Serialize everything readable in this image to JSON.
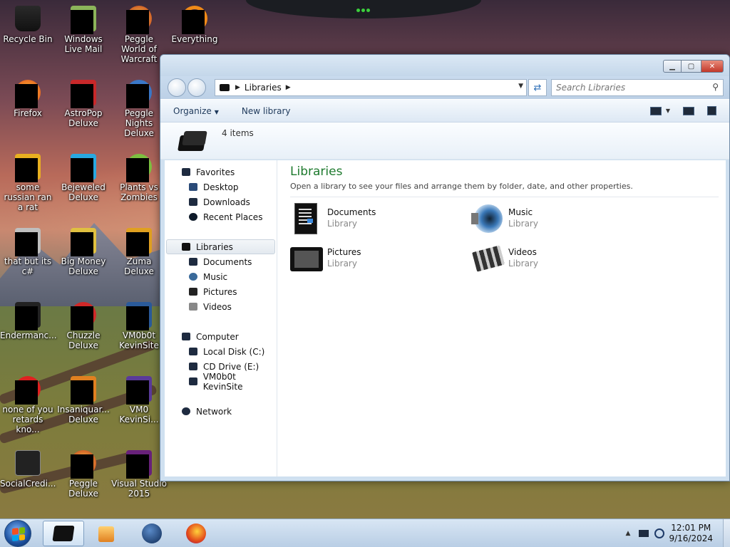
{
  "desktop": {
    "icons": [
      {
        "label": "Recycle Bin",
        "icon": "recycle-bin-icon"
      },
      {
        "label": "Windows Live Mail",
        "icon": "mail-icon"
      },
      {
        "label": "Peggle World of Warcraft",
        "icon": "game-icon"
      },
      {
        "label": "Everything",
        "icon": "search-app-icon"
      },
      {
        "label": "Firefox",
        "icon": "firefox-icon"
      },
      {
        "label": "AstroPop Deluxe",
        "icon": "game-icon"
      },
      {
        "label": "Peggle Nights Deluxe",
        "icon": "game-icon"
      },
      {
        "label": "some russian ran a rat",
        "icon": "app-icon"
      },
      {
        "label": "Bejeweled Deluxe",
        "icon": "game-icon"
      },
      {
        "label": "Plants vs Zombies",
        "icon": "game-icon"
      },
      {
        "label": "that but its c#",
        "icon": "app-icon"
      },
      {
        "label": "Big Money Deluxe",
        "icon": "game-icon"
      },
      {
        "label": "Zuma Deluxe",
        "icon": "game-icon"
      },
      {
        "label": "Endermanc...",
        "icon": "app-icon"
      },
      {
        "label": "Chuzzle Deluxe",
        "icon": "game-icon"
      },
      {
        "label": "VM0b0t KevinSite",
        "icon": "app-icon"
      },
      {
        "label": "none of you retards kno...",
        "icon": "app-icon"
      },
      {
        "label": "Insaniquar... Deluxe",
        "icon": "game-icon"
      },
      {
        "label": "VM0 KevinSi...",
        "icon": "app-icon"
      },
      {
        "label": "SocialCredi...",
        "icon": "app-icon"
      },
      {
        "label": "Peggle Deluxe",
        "icon": "game-icon"
      },
      {
        "label": "Visual Studio 2015",
        "icon": "visual-studio-icon"
      }
    ]
  },
  "window": {
    "address": {
      "crumb": "Libraries"
    },
    "search": {
      "placeholder": "Search Libraries"
    },
    "commands": {
      "organize": "Organize",
      "new_library": "New library"
    },
    "info": {
      "count": "4 items"
    },
    "nav": {
      "favorites": "Favorites",
      "favorite_items": [
        "Desktop",
        "Downloads",
        "Recent Places"
      ],
      "libraries": "Libraries",
      "library_items": [
        "Documents",
        "Music",
        "Pictures",
        "Videos"
      ],
      "computer": "Computer",
      "computer_items": [
        "Local Disk (C:)",
        "CD Drive (E:)",
        "VM0b0t KevinSite"
      ],
      "network": "Network"
    },
    "main": {
      "title": "Libraries",
      "description": "Open a library to see your files and arrange them by folder, date, and other properties.",
      "libraries": [
        {
          "name": "Documents",
          "kind": "Library"
        },
        {
          "name": "Music",
          "kind": "Library"
        },
        {
          "name": "Pictures",
          "kind": "Library"
        },
        {
          "name": "Videos",
          "kind": "Library"
        }
      ]
    }
  },
  "taskbar": {
    "clock": {
      "time": "12:01 PM",
      "date": "9/16/2024"
    }
  },
  "colors": {
    "title_green": "#1e7a2e",
    "accent_blue": "#2d6fb8"
  }
}
